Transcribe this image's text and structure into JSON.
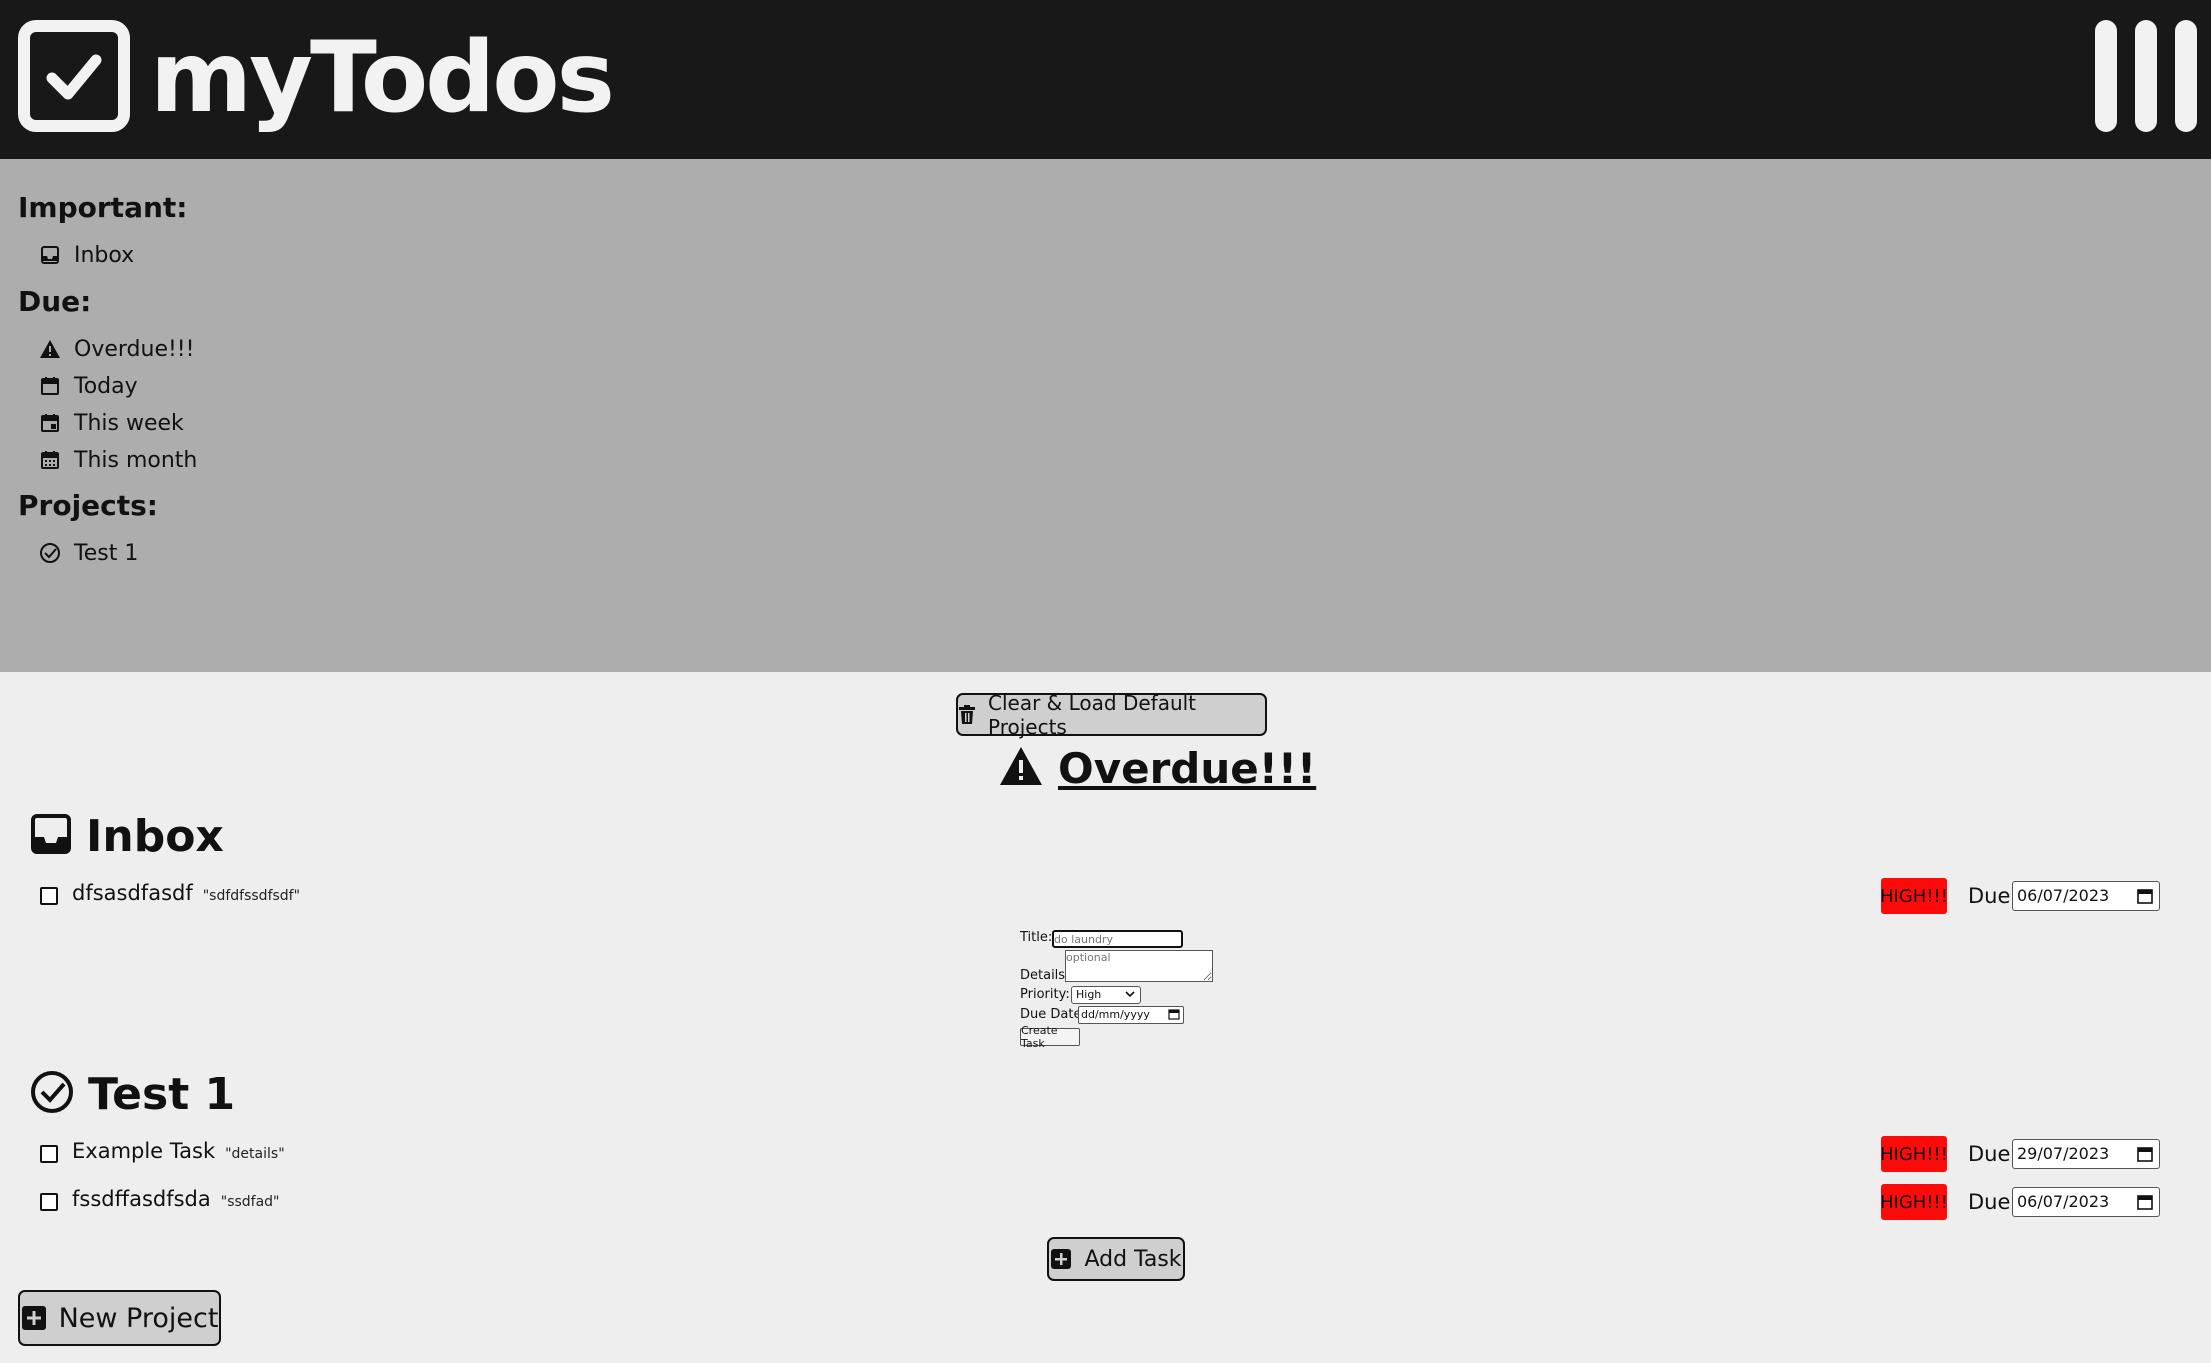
{
  "app": {
    "title": "myTodos"
  },
  "sidebar": {
    "important_heading": "Important:",
    "important_items": [
      {
        "label": "Inbox",
        "icon": "inbox-icon"
      }
    ],
    "due_heading": "Due:",
    "due_items": [
      {
        "label": "Overdue!!!",
        "icon": "warning-icon"
      },
      {
        "label": "Today",
        "icon": "calendar-icon"
      },
      {
        "label": "This week",
        "icon": "calendar-week-icon"
      },
      {
        "label": "This month",
        "icon": "calendar-month-icon"
      }
    ],
    "projects_heading": "Projects:",
    "project_items": [
      {
        "label": "Test 1",
        "icon": "check-circle-icon"
      }
    ]
  },
  "main": {
    "clear_button_label": "Clear & Load Default Projects",
    "view_title": "Overdue!!!",
    "projects": [
      {
        "name": "Inbox",
        "icon": "inbox-icon",
        "tasks": [
          {
            "title": "dfsasdfasdf",
            "details": "\"sdfdfssdfsdf\"",
            "priority": "HIGH!!!",
            "due_label": "Due:",
            "due_date": "06/07/2023"
          }
        ]
      },
      {
        "name": "Test 1",
        "icon": "check-circle-icon",
        "tasks": [
          {
            "title": "Example Task",
            "details": "\"details\"",
            "priority": "HIGH!!!",
            "due_label": "Due:",
            "due_date": "29/07/2023"
          },
          {
            "title": "fssdffasdfsda",
            "details": "\"ssdfad\"",
            "priority": "HIGH!!!",
            "due_label": "Due:",
            "due_date": "06/07/2023"
          }
        ]
      }
    ],
    "form": {
      "title_label": "Title:",
      "title_placeholder": "do laundry",
      "details_label": "Details:",
      "details_placeholder": "optional",
      "priority_label": "Priority:",
      "priority_value": "High",
      "due_label": "Due Date:",
      "due_placeholder": "dd/mm/yyyy",
      "create_label": "Create Task"
    },
    "add_task_label": "Add Task",
    "new_project_label": "New Project"
  },
  "colors": {
    "header_bg": "#181818",
    "sidebar_bg": "#adadad",
    "page_bg": "#eeeeee",
    "priority_high": "#ff0a0a"
  }
}
